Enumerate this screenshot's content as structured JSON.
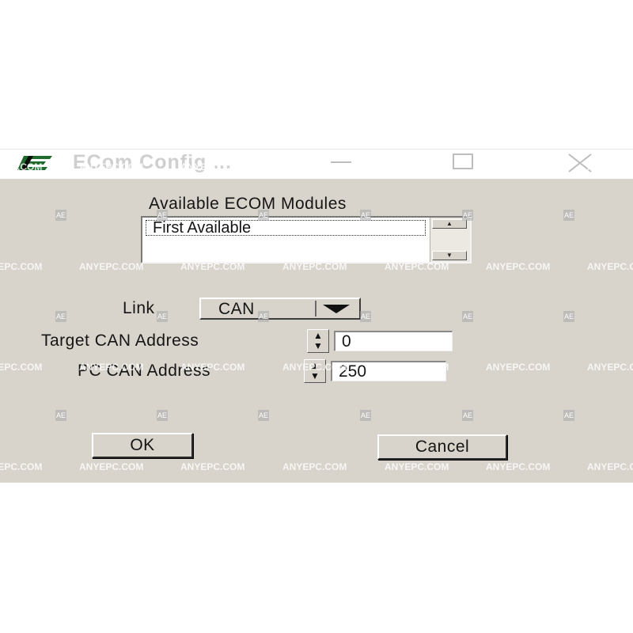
{
  "window": {
    "title": "ECom Config ..."
  },
  "modules": {
    "label": "Available  ECOM Modules",
    "items": [
      "First Available"
    ]
  },
  "link": {
    "label": "Link",
    "value": "CAN"
  },
  "target_address": {
    "label": "Target CAN Address",
    "value": "0"
  },
  "pc_address": {
    "label": "PC CAN Address",
    "value": "250"
  },
  "buttons": {
    "ok": "OK",
    "cancel": "Cancel"
  },
  "watermark": {
    "text": "ANYEPC.COM",
    "badge": "AE"
  },
  "colors": {
    "dialog_bg": "#d8d3cb",
    "logo_green": "#1f6b2e",
    "watermark": "#ffffff"
  },
  "icons": {
    "app": "ecom-logo-icon",
    "minimize": "minimize-icon",
    "maximize": "maximize-icon",
    "close": "close-icon",
    "dropdown": "triangle-down-icon",
    "spinner": "up-down-arrows-icon"
  }
}
